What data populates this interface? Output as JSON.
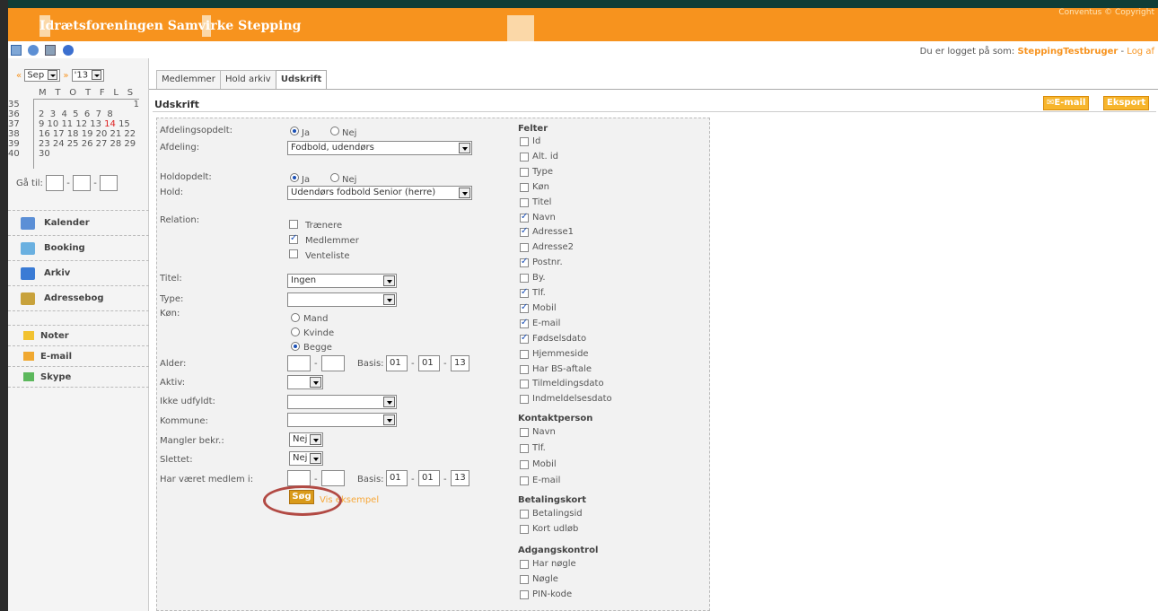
{
  "header": {
    "copyright": "Conventus © Copyright",
    "app_title": "Idrætsforeningen Samvirke Stepping",
    "logged_in_prefix": "Du er logget på som: ",
    "username": "SteppingTestbruger",
    "separator": " - ",
    "logoff": "Log af"
  },
  "calendar": {
    "prev": "«",
    "next": "»",
    "month": "Sep",
    "year": "'13",
    "weekday_header": "M T O T F L S",
    "rows": [
      {
        "week": "35",
        "days": "                                  1"
      },
      {
        "week": "36",
        "days": "2  3  4  5  6  7  8"
      },
      {
        "week": "37",
        "days": "9 10 11 12 13 14 15",
        "highlight": "14"
      },
      {
        "week": "38",
        "days": "16 17 18 19 20 21 22"
      },
      {
        "week": "39",
        "days": "23 24 25 26 27 28 29"
      },
      {
        "week": "40",
        "days": "30"
      }
    ],
    "goto_label": "Gå til:",
    "goto_sep": "-"
  },
  "nav": {
    "items": [
      {
        "label": "Kalender",
        "icon": "calendar-icon"
      },
      {
        "label": "Booking",
        "icon": "booking-icon"
      },
      {
        "label": "Arkiv",
        "icon": "archive-icon"
      },
      {
        "label": "Adressebog",
        "icon": "addressbook-icon"
      }
    ],
    "small_items": [
      {
        "label": "Noter",
        "icon": "note-icon"
      },
      {
        "label": "E-mail",
        "icon": "email-icon"
      },
      {
        "label": "Skype",
        "icon": "skype-icon"
      }
    ]
  },
  "tabs": [
    "Medlemmer",
    "Hold arkiv",
    "Udskrift"
  ],
  "section_title": "Udskrift",
  "buttons": {
    "email": "E-mail",
    "export": "Eksport",
    "search": "Søg",
    "example": "Vis eksempel"
  },
  "form": {
    "afdelingsopdelt": "Afdelingsopdelt:",
    "ja": "Ja",
    "nej": "Nej",
    "afdeling": "Afdeling:",
    "afdeling_value": "Fodbold, udendørs",
    "holdopdelt": "Holdopdelt:",
    "hold": "Hold:",
    "hold_value": "Udendørs fodbold Senior (herre)",
    "relation": "Relation:",
    "relation_options": [
      "Trænere",
      "Medlemmer",
      "Venteliste"
    ],
    "titel": "Titel:",
    "titel_value": "Ingen",
    "type": "Type:",
    "koen": "Køn:",
    "koen_options": [
      "Mand",
      "Kvinde",
      "Begge"
    ],
    "alder": "Alder:",
    "basis": "Basis:",
    "basis_values": [
      "01",
      "01",
      "13"
    ],
    "aktiv": "Aktiv:",
    "ikke_udfyldt": "Ikke udfyldt:",
    "kommune": "Kommune:",
    "mangler_bekr": "Mangler bekr.:",
    "nej_value": "Nej",
    "slettet": "Slettet:",
    "har_vaeret": "Har været medlem i:",
    "dash": "-"
  },
  "fields": {
    "felter_title": "Felter",
    "felter": [
      {
        "label": "Id",
        "checked": false
      },
      {
        "label": "Alt. id",
        "checked": false
      },
      {
        "label": "Type",
        "checked": false
      },
      {
        "label": "Køn",
        "checked": false
      },
      {
        "label": "Titel",
        "checked": false
      },
      {
        "label": "Navn",
        "checked": true
      },
      {
        "label": "Adresse1",
        "checked": true
      },
      {
        "label": "Adresse2",
        "checked": false
      },
      {
        "label": "Postnr.",
        "checked": true
      },
      {
        "label": "By.",
        "checked": false
      },
      {
        "label": "Tlf.",
        "checked": true
      },
      {
        "label": "Mobil",
        "checked": true
      },
      {
        "label": "E-mail",
        "checked": true
      },
      {
        "label": "Fødselsdato",
        "checked": true
      },
      {
        "label": "Hjemmeside",
        "checked": false
      },
      {
        "label": "Har BS-aftale",
        "checked": false
      },
      {
        "label": "Tilmeldingsdato",
        "checked": false
      },
      {
        "label": "Indmeldelsesdato",
        "checked": false
      }
    ],
    "kontakt_title": "Kontaktperson",
    "kontakt": [
      "Navn",
      "Tlf.",
      "Mobil",
      "E-mail"
    ],
    "betaling_title": "Betalingskort",
    "betaling": [
      "Betalingsid",
      "Kort udløb"
    ],
    "adgang_title": "Adgangskontrol",
    "adgang": [
      "Har nøgle",
      "Nøgle",
      "PIN-kode"
    ]
  }
}
